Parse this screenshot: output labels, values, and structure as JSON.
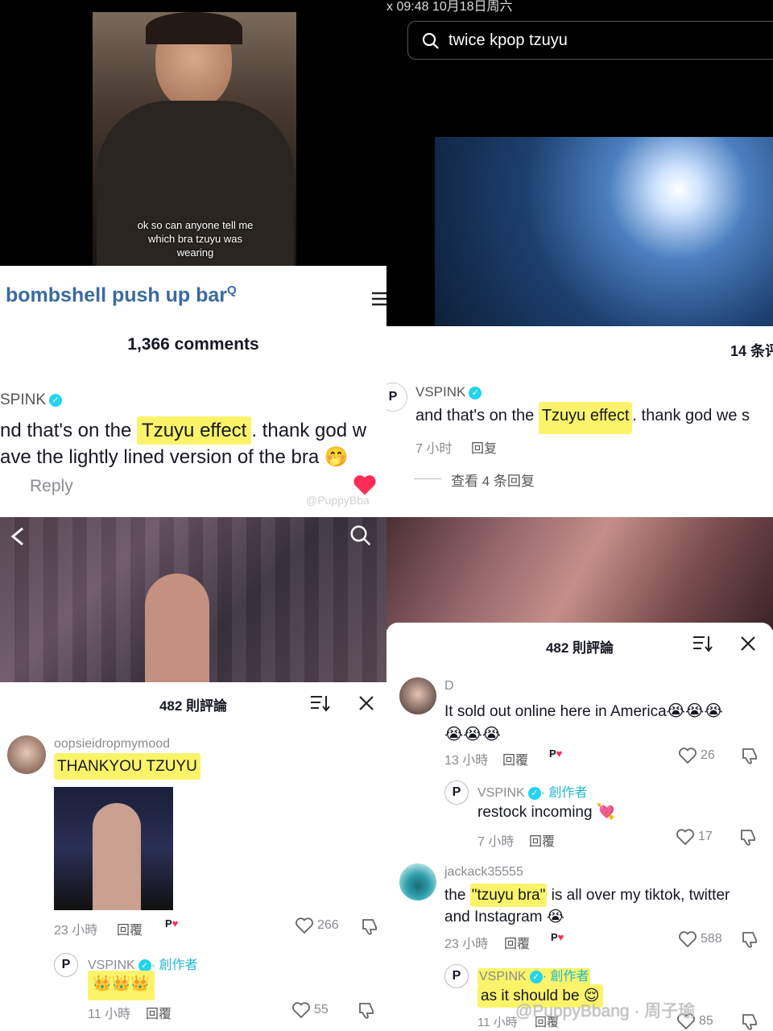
{
  "top_left": {
    "caption_lines": [
      "ok so can anyone tell me",
      "which bra tzuyu was",
      "wearing"
    ]
  },
  "top_right": {
    "status_time": "x  09:48   10月18日周六",
    "search_query": "twice kpop tzuyu"
  },
  "mid_left": {
    "search_term": "bombshell push up bar",
    "comments_count": "1,366 comments",
    "username": "SPINK",
    "comment_line1_pre": "nd that's on the ",
    "comment_highlight": "Tzuyu effect",
    "comment_line1_post": ". thank god w",
    "comment_line2": "ave the lightly lined version of the bra",
    "reply_label": "Reply",
    "watermark": "@PuppyBba"
  },
  "mid_right": {
    "count_label": "14 条评",
    "username": "VSPINK",
    "comment_pre": "and that's on the ",
    "comment_highlight": "Tzuyu effect",
    "comment_post": ". thank god we s",
    "time": "7 小时",
    "reply": "回复",
    "view_replies": "查看 4 条回复"
  },
  "bottom_left": {
    "header": "482 則評論",
    "comment1": {
      "user": "oopsieidropmymood",
      "text": "THANKYOU TZUYU",
      "time": "23 小時",
      "reply": "回覆",
      "likes": "266"
    },
    "reply1": {
      "user": "VSPINK",
      "creator_tag": "· 創作者",
      "text": "👑👑👑",
      "time": "11 小時",
      "reply": "回覆",
      "likes": "55"
    }
  },
  "bottom_right": {
    "header": "482 則評論",
    "comment1": {
      "user": "D",
      "text": "It sold out online here in America",
      "emojis1": "😭😭😭",
      "emojis2": "😭😭😭",
      "time": "13 小時",
      "reply": "回覆",
      "likes": "26"
    },
    "reply1": {
      "user": "VSPINK",
      "creator_tag": "· 創作者",
      "text": "restock incoming 💘",
      "time": "7 小時",
      "reply": "回覆",
      "likes": "17"
    },
    "comment2": {
      "user": "jackack35555",
      "text_pre": "the ",
      "text_highlight": "\"tzuyu bra\"",
      "text_post": " is all over my tiktok, twitter",
      "text_line2": "and Instagram 😭",
      "time": "23 小時",
      "reply": "回覆",
      "likes": "588"
    },
    "reply2": {
      "user": "VSPINK",
      "creator_tag": "· 創作者",
      "text": "as it should be 😌",
      "time": "11 小時",
      "reply": "回覆",
      "likes": "85"
    },
    "watermark": "@PuppyBbang · 周子瑜"
  },
  "colors": {
    "highlight": "#fbf46a",
    "verified": "#20d5ec",
    "link_blue": "#3a6aa0",
    "heart_red": "#fe2c55"
  }
}
